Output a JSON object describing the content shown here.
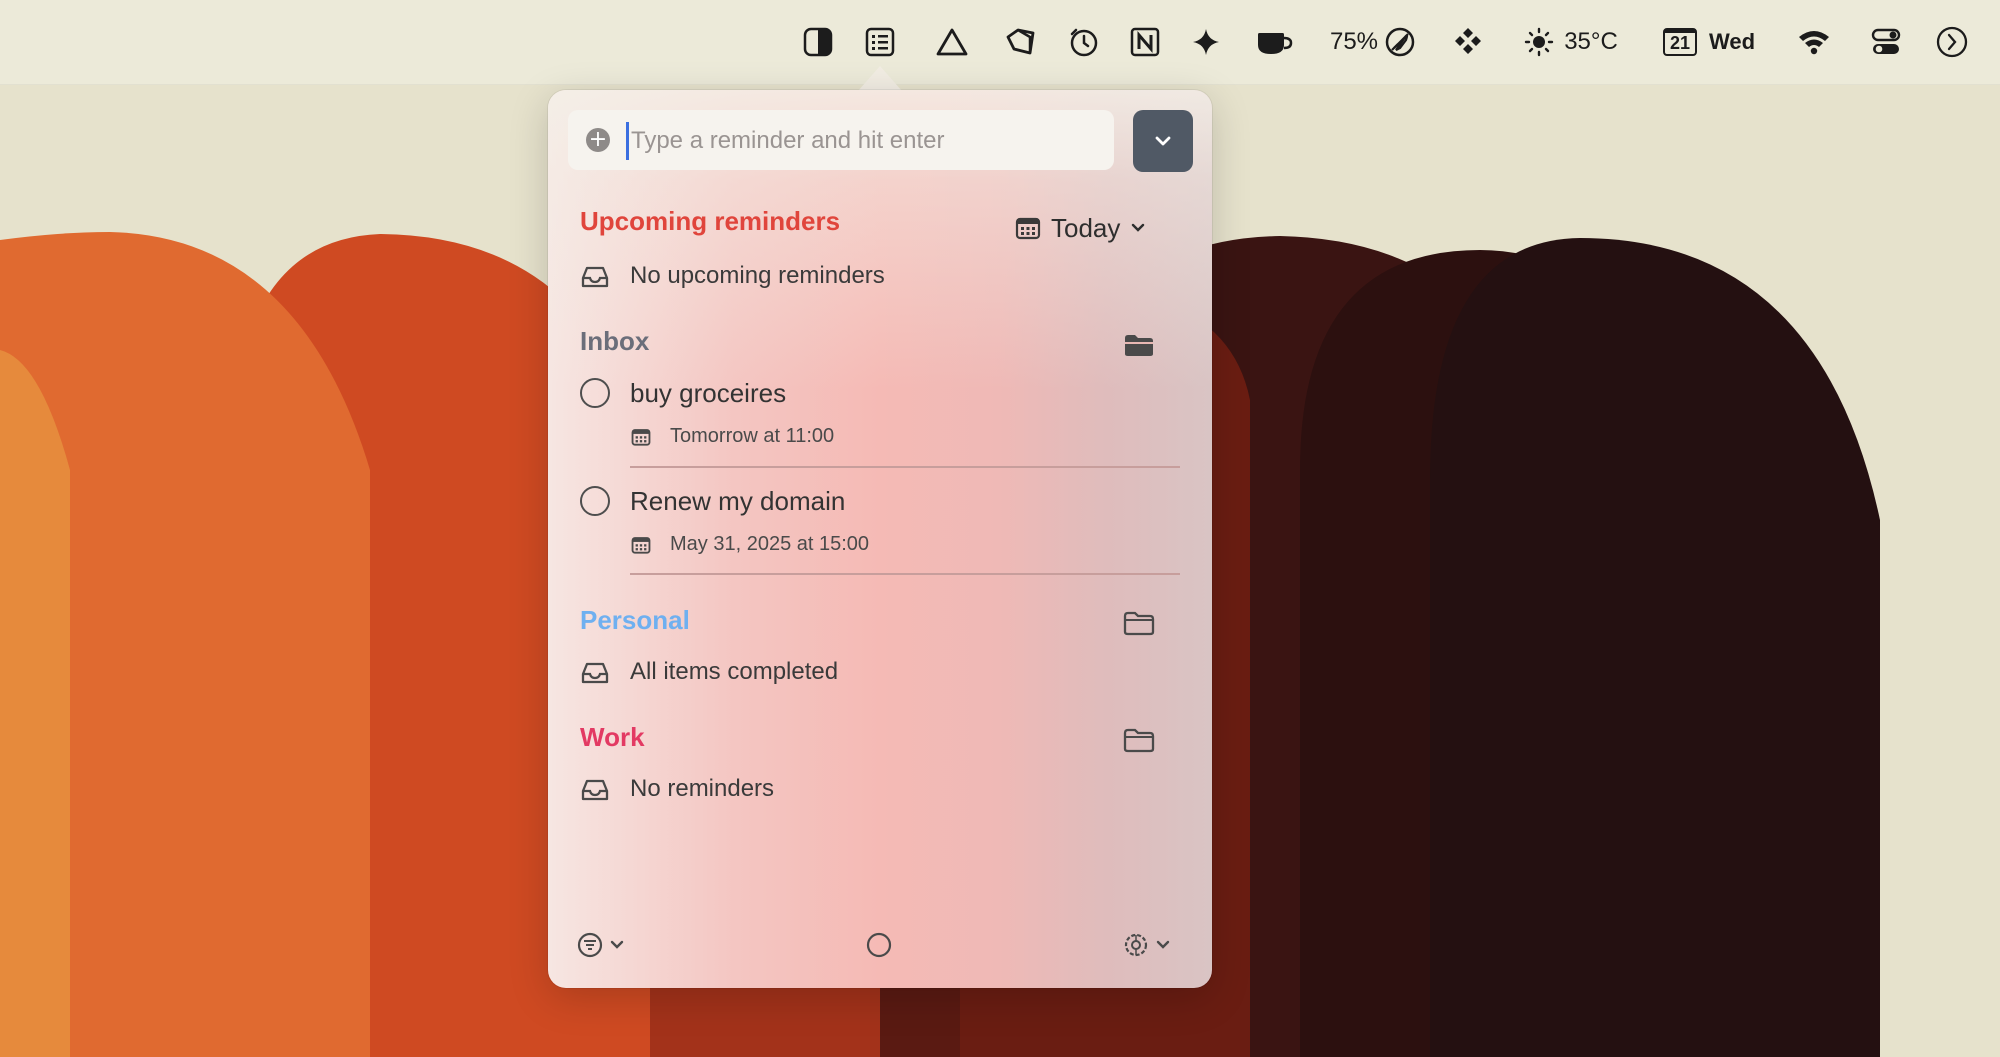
{
  "menubar": {
    "icons": [
      "contrast-icon",
      "reminders-list-icon",
      "triangle-icon",
      "tag-icon",
      "timer-icon",
      "notion-icon",
      "sparkle-icon",
      "coffee-cup-icon",
      "rocket-icon",
      "diamond-dots-icon",
      "sun-icon",
      "wifi-icon",
      "control-center-icon",
      "menu-chevron-icon"
    ],
    "battery_percent": "75%",
    "temperature": "35°C",
    "date_day": "21",
    "weekday": "Wed"
  },
  "input": {
    "placeholder": "Type a reminder and hit enter"
  },
  "upcoming": {
    "title": "Upcoming reminders",
    "title_color": "#e0453c",
    "filter_label": "Today",
    "empty_text": "No upcoming reminders"
  },
  "inbox": {
    "title": "Inbox",
    "title_color": "#6b6e7a",
    "items": [
      {
        "title": "buy groceires",
        "due": "Tomorrow at 11:00"
      },
      {
        "title": "Renew my domain",
        "due": "May 31, 2025 at 15:00"
      }
    ]
  },
  "personal": {
    "title": "Personal",
    "title_color": "#6fb0f0",
    "empty_text": "All items completed"
  },
  "work": {
    "title": "Work",
    "title_color": "#e33a63",
    "empty_text": "No reminders"
  },
  "footer": {
    "icons": [
      "filter-icon",
      "circle-icon",
      "settings-gear-icon"
    ]
  }
}
